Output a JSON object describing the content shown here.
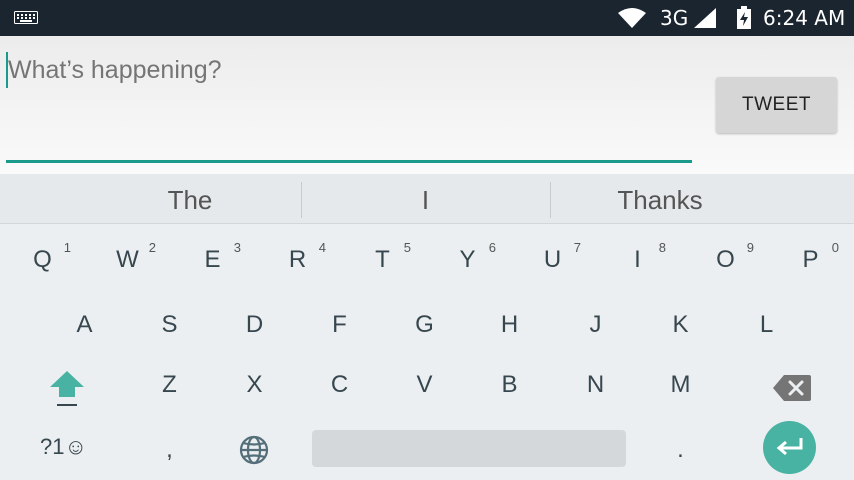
{
  "status_bar": {
    "network": "3G",
    "time": "6:24 AM",
    "icons": [
      "keyboard-indicator-icon",
      "wifi-icon",
      "signal-icon",
      "battery-charging-icon"
    ]
  },
  "compose": {
    "placeholder": "What’s happening?",
    "tweet_label": "TWEET"
  },
  "suggestions": [
    "The",
    "I",
    "Thanks"
  ],
  "keyboard": {
    "row1": [
      {
        "label": "Q",
        "hint": "1"
      },
      {
        "label": "W",
        "hint": "2"
      },
      {
        "label": "E",
        "hint": "3"
      },
      {
        "label": "R",
        "hint": "4"
      },
      {
        "label": "T",
        "hint": "5"
      },
      {
        "label": "Y",
        "hint": "6"
      },
      {
        "label": "U",
        "hint": "7"
      },
      {
        "label": "I",
        "hint": "8"
      },
      {
        "label": "O",
        "hint": "9"
      },
      {
        "label": "P",
        "hint": "0"
      }
    ],
    "row2": [
      "A",
      "S",
      "D",
      "F",
      "G",
      "H",
      "J",
      "K",
      "L"
    ],
    "row3": [
      "Z",
      "X",
      "C",
      "V",
      "B",
      "N",
      "M"
    ],
    "bottom": {
      "symbols_label": "?1☺",
      "comma_label": ",",
      "period_label": "."
    },
    "special_icons": [
      "shift-icon",
      "backspace-icon",
      "globe-icon",
      "enter-icon"
    ],
    "accent_color": "#48b3a3"
  }
}
